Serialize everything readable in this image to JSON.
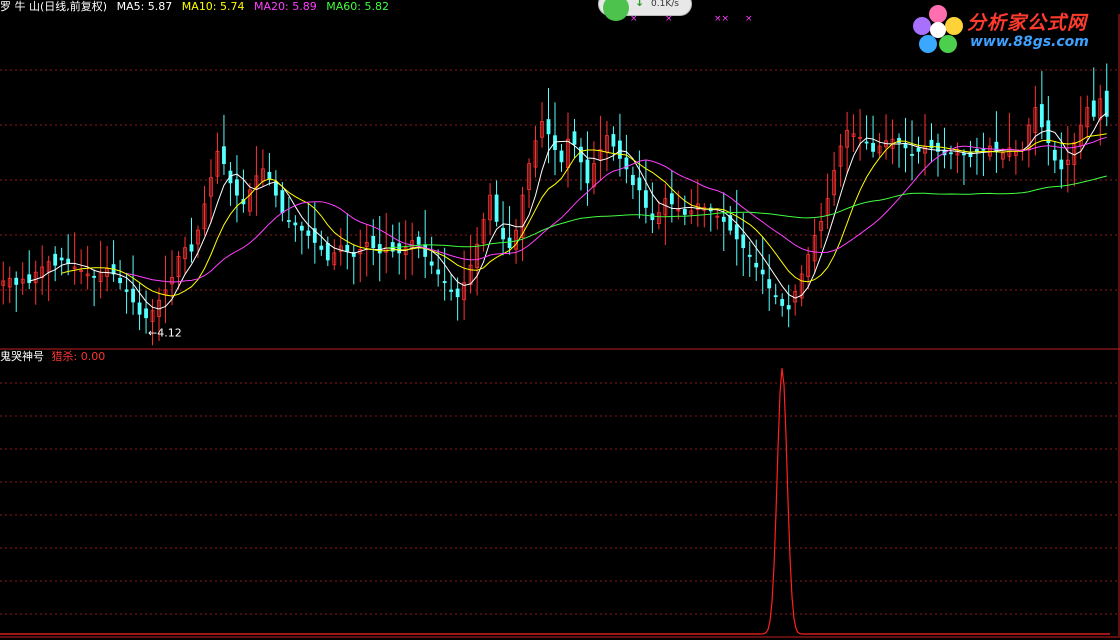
{
  "header": {
    "title": "罗 牛 山(日线,前复权)",
    "ma5": "MA5: 5.87",
    "ma10": "MA10: 5.74",
    "ma20": "MA20: 5.89",
    "ma60": "MA60: 5.82"
  },
  "network": {
    "speed": "0.1K/s"
  },
  "low_marker": "←4.12",
  "markers": [
    "×",
    "×",
    "××",
    "×"
  ],
  "indicator": {
    "name": "鬼哭神号",
    "value_label": "猎杀: 0.00"
  },
  "logo": {
    "name": "分析家公式网",
    "url": "www.88gs.com"
  },
  "colors": {
    "up": "#ff3333",
    "down": "#54ffff",
    "ma5": "#ffffff",
    "ma10": "#ffff00",
    "ma20": "#ff40ff",
    "ma60": "#40ff40",
    "indicator": "#ff2020",
    "grid": "#8a1a1a"
  },
  "chart_data": [
    {
      "type": "candlestick",
      "title": "罗 牛 山(日线,前复权)",
      "ylim": [
        3.9,
        7.6
      ],
      "min_low": 4.12,
      "series": [
        {
          "name": "MA5",
          "value": 5.87
        },
        {
          "name": "MA10",
          "value": 5.74
        },
        {
          "name": "MA20",
          "value": 5.89
        },
        {
          "name": "MA60",
          "value": 5.82
        }
      ],
      "close": [
        4.62,
        4.65,
        4.58,
        4.64,
        4.6,
        4.72,
        4.78,
        4.84,
        4.8,
        4.86,
        4.82,
        4.78,
        4.74,
        4.7,
        4.66,
        4.72,
        4.76,
        4.7,
        4.6,
        4.5,
        4.38,
        4.24,
        4.2,
        4.28,
        4.4,
        4.52,
        4.66,
        4.9,
        5.0,
        4.96,
        5.2,
        5.5,
        5.8,
        6.1,
        5.96,
        5.74,
        5.6,
        5.5,
        5.66,
        5.82,
        5.9,
        5.78,
        5.6,
        5.4,
        5.3,
        5.26,
        5.2,
        5.14,
        5.06,
        4.98,
        4.86,
        4.94,
        5.02,
        4.96,
        4.9,
        4.98,
        5.06,
        5.0,
        4.94,
        5.0,
        4.96,
        4.94,
        5.0,
        5.08,
        5.04,
        4.9,
        4.8,
        4.7,
        4.6,
        4.5,
        4.44,
        4.6,
        4.8,
        5.04,
        5.32,
        5.6,
        5.3,
        5.1,
        5.0,
        5.2,
        5.6,
        5.96,
        6.22,
        6.44,
        6.3,
        6.12,
        5.98,
        6.24,
        6.18,
        5.98,
        5.74,
        5.96,
        6.12,
        6.28,
        6.16,
        6.02,
        5.9,
        5.72,
        5.66,
        5.46,
        5.32,
        5.4,
        5.56,
        5.5,
        5.44,
        5.38,
        5.42,
        5.5,
        5.46,
        5.42,
        5.36,
        5.3,
        5.2,
        5.1,
        5.0,
        4.9,
        4.78,
        4.7,
        4.54,
        4.44,
        4.34,
        4.3,
        4.5,
        4.7,
        4.92,
        5.14,
        5.3,
        5.56,
        5.88,
        6.16,
        6.34,
        6.3,
        6.26,
        6.2,
        6.1,
        6.16,
        6.22,
        6.24,
        6.2,
        6.14,
        6.06,
        6.1,
        6.16,
        6.14,
        6.1,
        6.06,
        6.08,
        6.12,
        6.06,
        6.04,
        6.1,
        6.12,
        6.16,
        6.1,
        6.08,
        6.14,
        6.1,
        6.12,
        6.4,
        6.6,
        6.38,
        6.2,
        6.0,
        5.9,
        6.0,
        6.2,
        6.4,
        6.6,
        6.5,
        6.7,
        6.5
      ],
      "indicator": {
        "name": "鬼哭神号",
        "series_name": "猎杀",
        "last_value": 0.0,
        "spike_at_bar": 120,
        "spike_value": 1.0
      }
    }
  ]
}
